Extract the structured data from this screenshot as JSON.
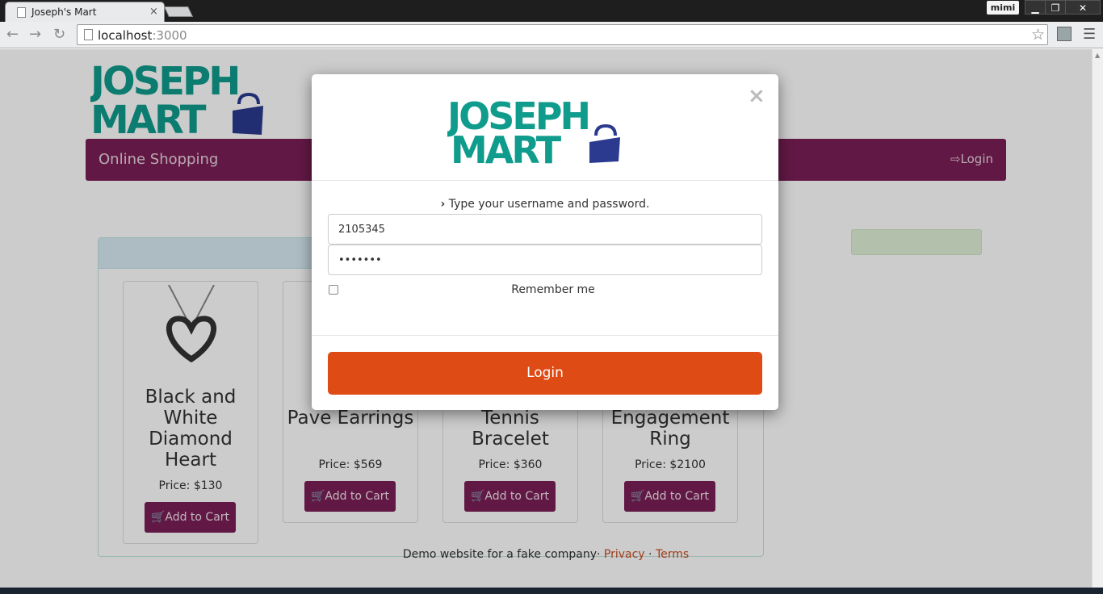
{
  "browser": {
    "tab_title": "Joseph's Mart",
    "tab_close": "×",
    "profile_name": "mimi",
    "minimize": "▁",
    "restore": "❐",
    "close": "✕",
    "url_host": "localhost",
    "url_port": ":3000",
    "star_icon": "☆",
    "menu_icon": "☰",
    "back_icon": "←",
    "forward_icon": "→",
    "reload_icon": "↻"
  },
  "site": {
    "logo_line1": "JOSEPH",
    "logo_line2": "MART",
    "brand_color": "#0f9c8c",
    "accent_color": "#7b1f55",
    "navbar_brand": "Online Shopping",
    "nav_login": "Login"
  },
  "products": [
    {
      "name": "Black and White Diamond Heart",
      "price": "Price: $130",
      "button": "Add to Cart"
    },
    {
      "name": "Pave Earrings",
      "price": "Price: $569",
      "button": "Add to Cart"
    },
    {
      "name": "Tennis Bracelet",
      "price": "Price: $360",
      "button": "Add to Cart"
    },
    {
      "name": "Engagement Ring",
      "price": "Price: $2100",
      "button": "Add to Cart"
    }
  ],
  "footer": {
    "text": "Demo website for a fake company·",
    "privacy": "Privacy",
    "separator": " · ",
    "terms": "Terms"
  },
  "modal": {
    "logo_line1": "JOSEPH",
    "logo_line2": "MART",
    "close": "×",
    "instruction": "Type your username and password.",
    "username_value": "2105345",
    "password_value": "•••••••",
    "remember_label": "Remember me",
    "remember_checked": false,
    "login_button": "Login",
    "login_color": "#de4b15"
  }
}
